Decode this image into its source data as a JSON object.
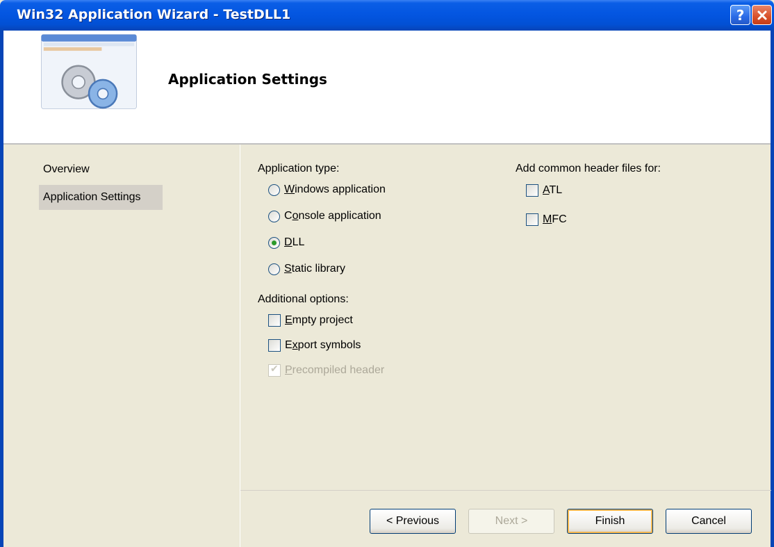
{
  "window": {
    "title": "Win32 Application Wizard - TestDLL1"
  },
  "titlebar": {
    "help_label": "?",
    "close_label": "✕"
  },
  "header": {
    "title": "Application Settings"
  },
  "nav": {
    "items": [
      {
        "label": "Overview"
      },
      {
        "label": "Application Settings"
      }
    ]
  },
  "app_type": {
    "label": "Application type:",
    "options": [
      {
        "mnemonic": "W",
        "rest": "indows application",
        "selected": false
      },
      {
        "mnemonic_pre": "C",
        "mnemonic": "o",
        "rest": "nsole application",
        "selected": false
      },
      {
        "mnemonic": "D",
        "rest": "LL",
        "selected": true
      },
      {
        "mnemonic": "S",
        "rest": "tatic library",
        "selected": false
      }
    ]
  },
  "additional": {
    "label": "Additional options:",
    "options": [
      {
        "mnemonic": "E",
        "rest": "mpty project",
        "checked": false,
        "enabled": true
      },
      {
        "pre": "E",
        "mnemonic": "x",
        "rest": "port symbols",
        "checked": false,
        "enabled": true
      },
      {
        "mnemonic": "P",
        "rest": "recompiled header",
        "checked": true,
        "enabled": false
      }
    ]
  },
  "headers": {
    "label": "Add common header files for:",
    "options": [
      {
        "mnemonic": "A",
        "rest": "TL",
        "checked": false
      },
      {
        "mnemonic": "M",
        "rest": "FC",
        "checked": false
      }
    ]
  },
  "buttons": {
    "previous": "< Previous",
    "next": "Next >",
    "finish": "Finish",
    "cancel": "Cancel"
  }
}
